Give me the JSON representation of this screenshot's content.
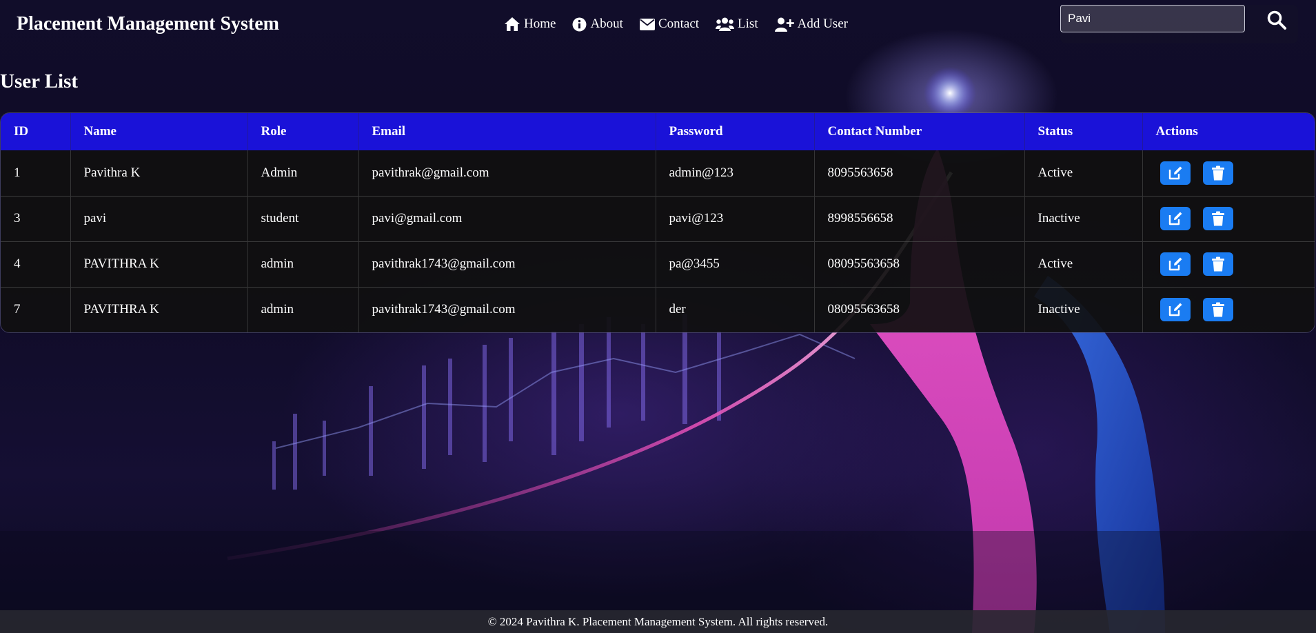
{
  "header": {
    "brand": "Placement Management System",
    "nav": [
      {
        "label": "Home",
        "icon": "home-icon"
      },
      {
        "label": "About",
        "icon": "info-icon"
      },
      {
        "label": "Contact",
        "icon": "envelope-icon"
      },
      {
        "label": "List",
        "icon": "users-icon"
      },
      {
        "label": "Add User",
        "icon": "user-plus-icon"
      }
    ],
    "search": {
      "value": "Pavi",
      "button_icon": "search-icon"
    }
  },
  "page": {
    "title": "User List"
  },
  "table": {
    "columns": [
      "ID",
      "Name",
      "Role",
      "Email",
      "Password",
      "Contact Number",
      "Status",
      "Actions"
    ],
    "rows": [
      {
        "id": "1",
        "name": "Pavithra K",
        "role": "Admin",
        "email": "pavithrak@gmail.com",
        "password": "admin@123",
        "contact": "8095563658",
        "status": "Active"
      },
      {
        "id": "3",
        "name": "pavi",
        "role": "student",
        "email": "pavi@gmail.com",
        "password": "pavi@123",
        "contact": "8998556658",
        "status": "Inactive"
      },
      {
        "id": "4",
        "name": "PAVITHRA K",
        "role": "admin",
        "email": "pavithrak1743@gmail.com",
        "password": "pa@3455",
        "contact": "08095563658",
        "status": "Active"
      },
      {
        "id": "7",
        "name": "PAVITHRA K",
        "role": "admin",
        "email": "pavithrak1743@gmail.com",
        "password": "der",
        "contact": "08095563658",
        "status": "Inactive"
      }
    ],
    "row_actions": [
      {
        "name": "edit",
        "icon": "edit-icon"
      },
      {
        "name": "delete",
        "icon": "trash-icon"
      }
    ]
  },
  "footer": {
    "text": "© 2024 Pavithra K. Placement Management System. All rights reserved."
  },
  "colors": {
    "table_header": "#1a12d8",
    "action_button": "#1a7cf2",
    "row_background": "#101010",
    "page_background": "#0f0b26"
  }
}
